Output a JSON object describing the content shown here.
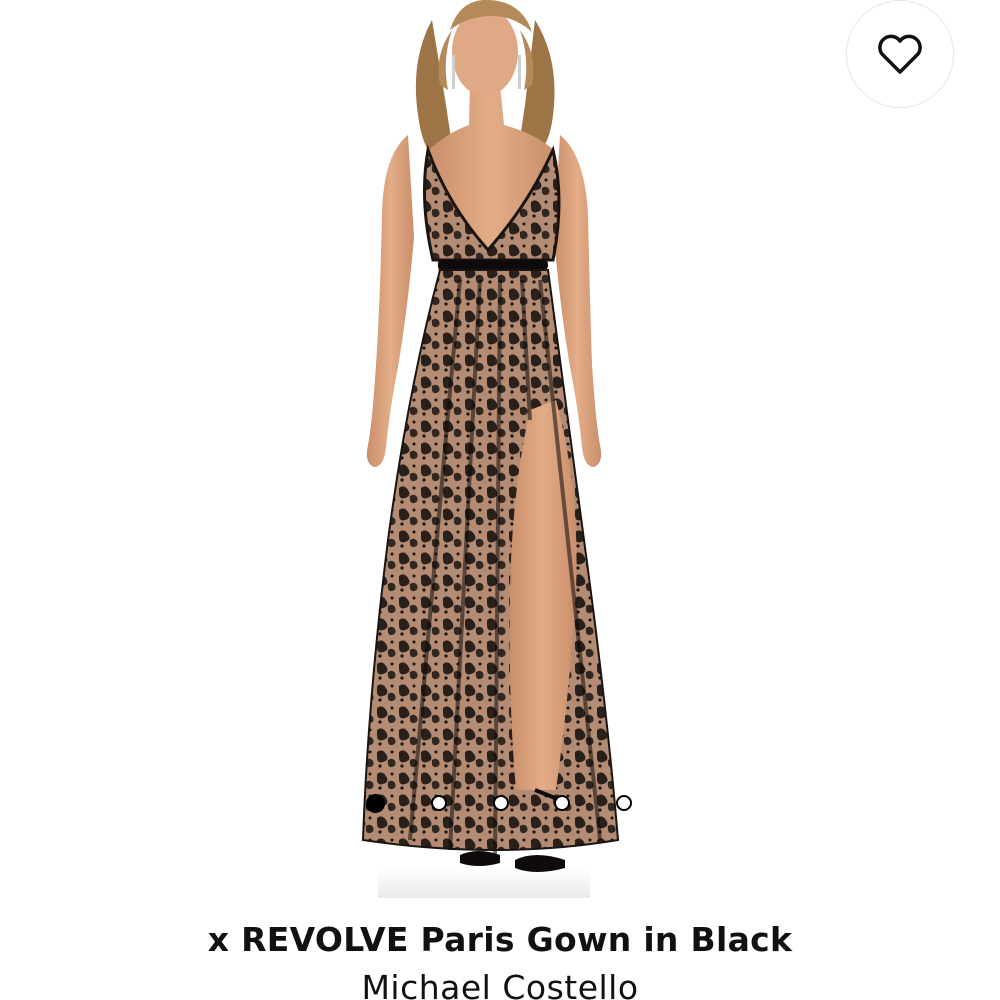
{
  "product": {
    "title": "x REVOLVE Paris Gown in Black",
    "brand": "Michael Costello"
  },
  "image_carousel": {
    "total_images": 5,
    "active_index": 0
  },
  "favorite": {
    "icon": "heart-outline-icon",
    "selected": false
  },
  "colors": {
    "background": "#ffffff",
    "text": "#111111",
    "dress": "#1a1412",
    "lining": "#b48c74",
    "skin": "#d9a27c",
    "hair": "#b58a5a"
  }
}
